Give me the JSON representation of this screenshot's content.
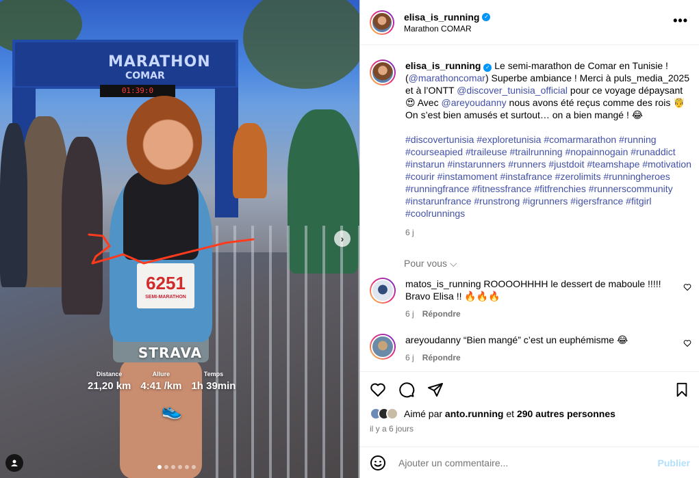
{
  "post": {
    "author": "elisa_is_running",
    "location": "Marathon COMAR",
    "caption_prefix": "Le semi-marathon de Comar en Tunisie ! (",
    "caption_mention1": "@marathoncomar",
    "caption_part2": ") Superbe ambiance ! Merci à puls_media_2025 et à l’ONTT ",
    "caption_mention2": "@discover_tunisia_official",
    "caption_part3": " pour ce voyage dépaysant 😍 Avec ",
    "caption_mention3": "@areyoudanny",
    "caption_part4": " nous avons été reçus comme des rois 🤴 On s’est bien amusés et surtout… on a bien mangé ! 😂",
    "hashtags": "#discovertunisia #exploretunisia #comarmarathon #running #courseapied #traileuse #trailrunning #nopainnogain #runaddict #instarun #instarunners #runners #justdoit #teamshape #motivation #courir #instamoment #instafrance  #zerolimits #runningheroes #runningfrance #fitnessfrance #fitfrenchies #runnerscommunity #instarunfrance #runstrong #igrunners #igersfrance #fitgirl #coolrunnings",
    "caption_time": "6 j",
    "see_all": "Pour vous"
  },
  "photo": {
    "arch_brand": "MARATHON",
    "arch_brand2": "COMAR",
    "clock": "01:39:0",
    "bib_number": "6251",
    "bib_label": "SEMI-MARATHON",
    "strava_logo": "STRAVA",
    "stats": [
      {
        "label": "Distance",
        "value": "21,20 km"
      },
      {
        "label": "Allure",
        "value": "4:41 /km"
      },
      {
        "label": "Temps",
        "value": "1h 39min"
      }
    ],
    "dots_count": 6,
    "active_dot": 0
  },
  "comments": [
    {
      "user": "matos_is_running",
      "text": "ROOOOHHHH le dessert de maboule !!!!! Bravo Elisa !! 🔥🔥🔥",
      "time": "6 j",
      "reply": "Répondre"
    },
    {
      "user": "areyoudanny",
      "text": "“Bien mangé” c’est un euphémisme 😂",
      "time": "6 j",
      "reply": "Répondre"
    }
  ],
  "likes": {
    "prefix": "Aimé par ",
    "user": "anto.running",
    "middle": " et ",
    "others": "290 autres personnes",
    "ago": "il y a 6 jours"
  },
  "add_comment": {
    "placeholder": "Ajouter un commentaire...",
    "post_label": "Publier"
  },
  "colors": {
    "link": "#4250a8",
    "verified": "#0095f6",
    "muted": "#737373"
  }
}
